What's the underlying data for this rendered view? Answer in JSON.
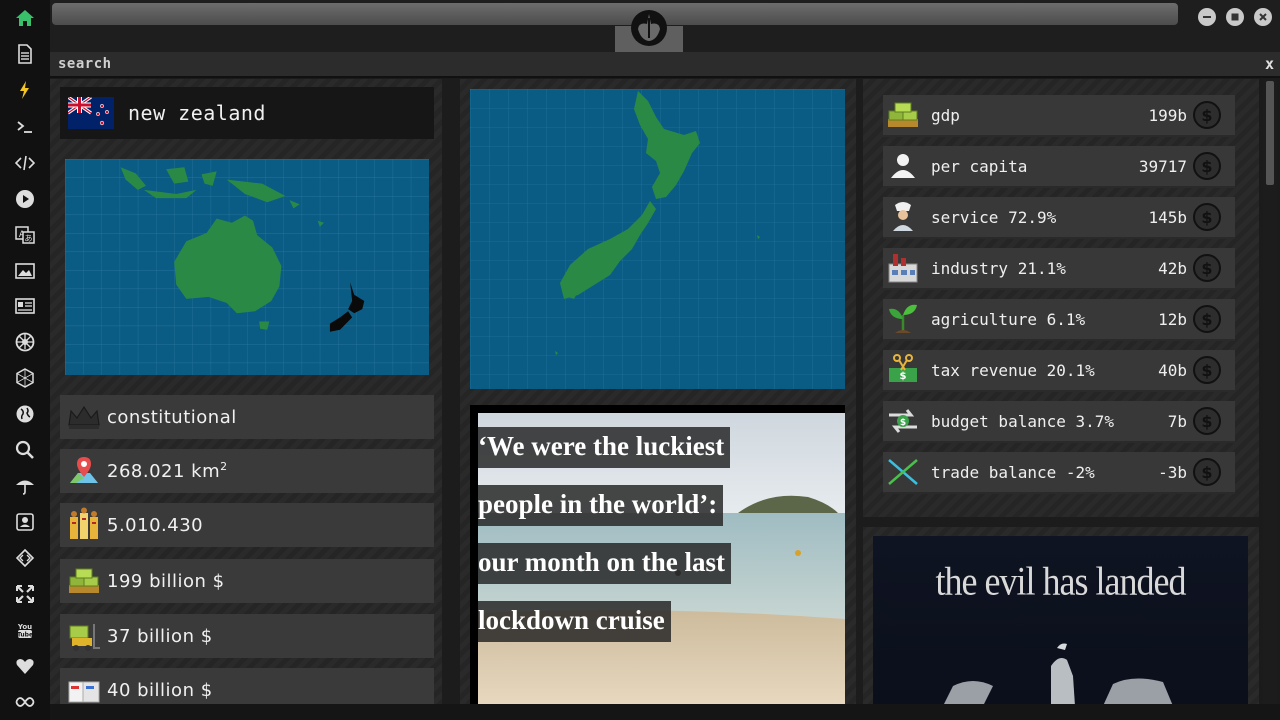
{
  "search": {
    "label": "search",
    "close": "x"
  },
  "rail": [
    {
      "name": "home-icon"
    },
    {
      "name": "document-icon"
    },
    {
      "name": "lightning-icon"
    },
    {
      "name": "terminal-icon"
    },
    {
      "name": "code-icon"
    },
    {
      "name": "play-icon"
    },
    {
      "name": "translate-icon"
    },
    {
      "name": "image-icon"
    },
    {
      "name": "newspaper-icon"
    },
    {
      "name": "empire-icon"
    },
    {
      "name": "hexagon-icon"
    },
    {
      "name": "globe-icon"
    },
    {
      "name": "search-icon"
    },
    {
      "name": "umbrella-icon"
    },
    {
      "name": "contact-icon"
    },
    {
      "name": "diamond-code-icon"
    },
    {
      "name": "expand-icon"
    },
    {
      "name": "youtube-icon"
    },
    {
      "name": "heart-icon"
    },
    {
      "name": "infinity-icon"
    }
  ],
  "country": {
    "name": "new zealand",
    "government": "constitutional",
    "area": "268.021 km",
    "area_unit_sup": "2",
    "population": "5.010.430",
    "gdp": "199 billion $",
    "item5": "37 billion $",
    "item6": "40 billion $"
  },
  "news": {
    "lines": [
      "‘We were the luckiest",
      "people in the world’:",
      "our month on the last",
      "lockdown cruise"
    ]
  },
  "economy": [
    {
      "label": "gdp",
      "value": "199b",
      "icon": "cash-stack-icon"
    },
    {
      "label": "per capita",
      "value": "39717",
      "icon": "person-icon"
    },
    {
      "label": "service 72.9%",
      "value": "145b",
      "icon": "chef-icon"
    },
    {
      "label": "industry 21.1%",
      "value": "42b",
      "icon": "factory-icon"
    },
    {
      "label": "agriculture 6.1%",
      "value": "12b",
      "icon": "sprout-icon"
    },
    {
      "label": "tax revenue 20.1%",
      "value": "40b",
      "icon": "tax-scissors-icon"
    },
    {
      "label": "budget balance 3.7%",
      "value": "7b",
      "icon": "exchange-icon"
    },
    {
      "label": "trade balance -2%",
      "value": "-3b",
      "icon": "trade-cross-icon"
    }
  ],
  "economy_currency_symbol": "$",
  "poster": {
    "title": "the evil has landed"
  },
  "colors": {
    "ocean": "#0b5c84",
    "land": "#2a8a45",
    "accent_green": "#39c06a"
  }
}
